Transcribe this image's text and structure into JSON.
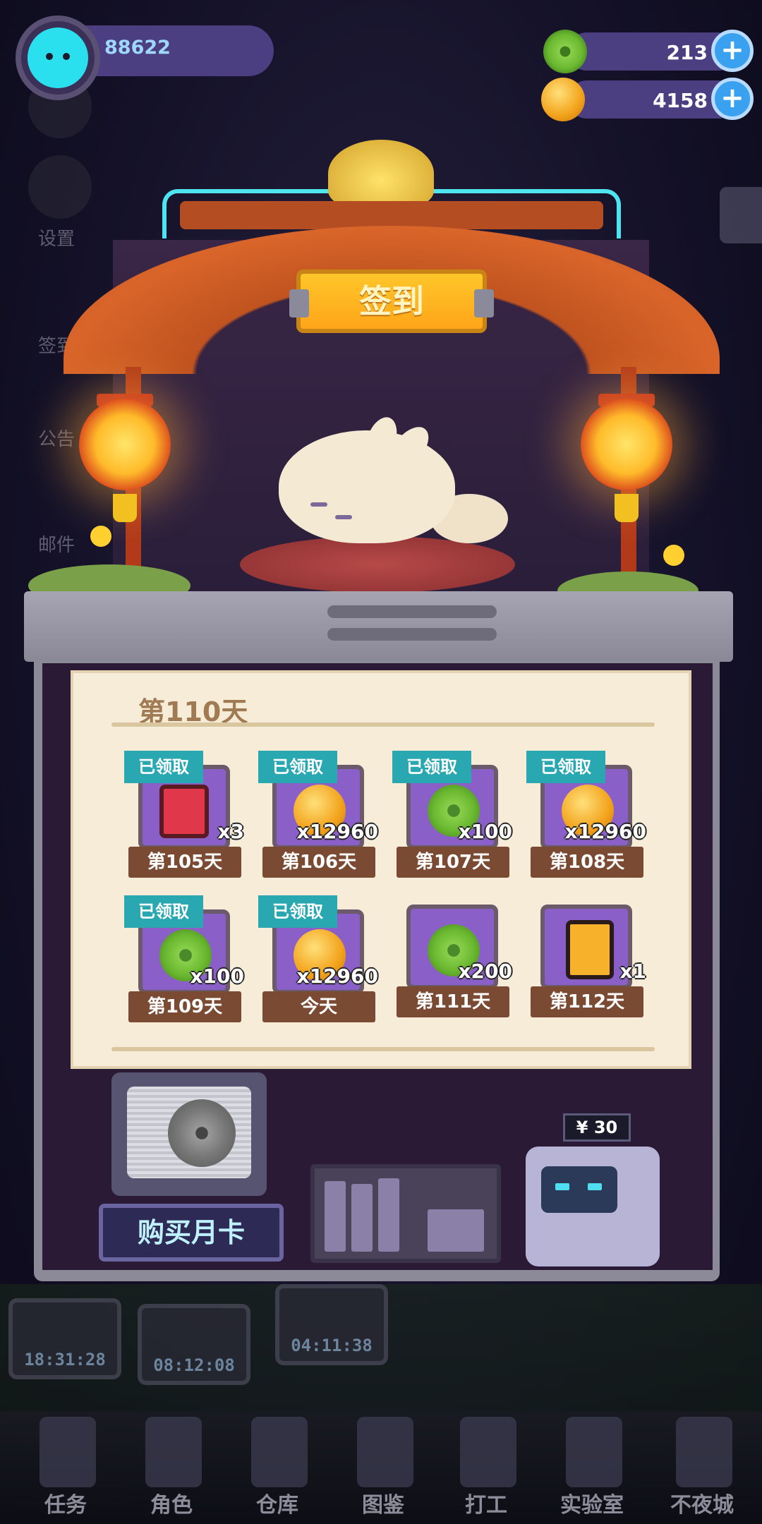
{
  "player": {
    "score": "88622"
  },
  "resources": [
    {
      "name": "jade",
      "value": "213",
      "icon": "jade-coin-icon"
    },
    {
      "name": "gold",
      "value": "4158",
      "icon": "gold-coin-icon"
    }
  ],
  "side_menu": [
    {
      "label": "设置",
      "icon": "gear-icon"
    },
    {
      "label": "签到",
      "icon": "checkin-icon"
    },
    {
      "label": "公告",
      "icon": "megaphone-icon"
    },
    {
      "label": "邮件",
      "icon": "mail-icon"
    }
  ],
  "shrine": {
    "sign": "签到"
  },
  "checkin": {
    "title": "第110天",
    "claimed_label": "已领取",
    "rewards": [
      {
        "day": "第105天",
        "qty": "x3",
        "icon": "red-card-icon",
        "claimed": true
      },
      {
        "day": "第106天",
        "qty": "x12960",
        "icon": "gold-coin-icon",
        "claimed": true
      },
      {
        "day": "第107天",
        "qty": "x100",
        "icon": "jade-coin-icon",
        "claimed": true
      },
      {
        "day": "第108天",
        "qty": "x12960",
        "icon": "gold-coin-icon",
        "claimed": true
      },
      {
        "day": "第109天",
        "qty": "x100",
        "icon": "jade-coin-icon",
        "claimed": true
      },
      {
        "day": "今天",
        "qty": "x12960",
        "icon": "gold-coin-icon",
        "claimed": true
      },
      {
        "day": "第111天",
        "qty": "x200",
        "icon": "jade-coin-icon",
        "claimed": false
      },
      {
        "day": "第112天",
        "qty": "x1",
        "icon": "battery-icon",
        "claimed": false
      }
    ]
  },
  "monthly_card": {
    "button": "购买月卡",
    "price": "¥ 30"
  },
  "background_timers": [
    "18:31:28",
    "08:12:08",
    "04:11:38"
  ],
  "bottom_nav": [
    {
      "label": "任务",
      "icon": "clipboard-icon"
    },
    {
      "label": "角色",
      "icon": "character-icon"
    },
    {
      "label": "仓库",
      "icon": "chest-icon"
    },
    {
      "label": "图鉴",
      "icon": "book-icon"
    },
    {
      "label": "打工",
      "icon": "work-icon"
    },
    {
      "label": "实验室",
      "icon": "lab-icon"
    },
    {
      "label": "不夜城",
      "icon": "city-icon"
    }
  ],
  "colors": {
    "claimed_tag": "#2aa8b2",
    "day_label_bg": "#7a4a32",
    "card_bg": "#8b5fc8",
    "sign_gold": "#ffb520",
    "top_bar": "#4b3f82"
  }
}
